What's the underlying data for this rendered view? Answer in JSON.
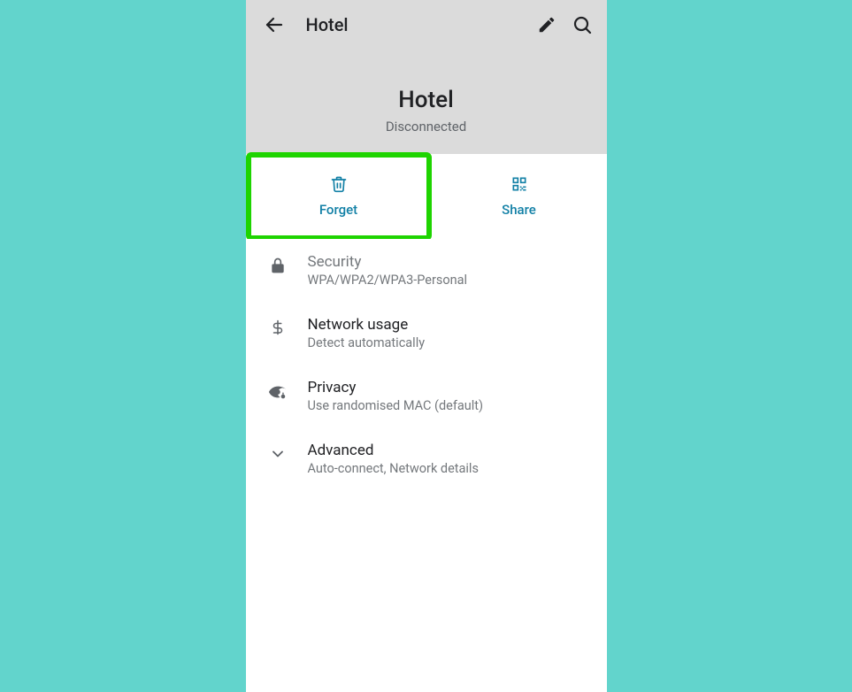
{
  "topbar": {
    "title": "Hotel"
  },
  "hero": {
    "name": "Hotel",
    "status": "Disconnected"
  },
  "actions": {
    "forget": "Forget",
    "share": "Share"
  },
  "rows": {
    "security": {
      "title": "Security",
      "sub": "WPA/WPA2/WPA3-Personal"
    },
    "usage": {
      "title": "Network usage",
      "sub": "Detect automatically"
    },
    "privacy": {
      "title": "Privacy",
      "sub": "Use randomised MAC (default)"
    },
    "advanced": {
      "title": "Advanced",
      "sub": "Auto-connect, Network details"
    }
  }
}
